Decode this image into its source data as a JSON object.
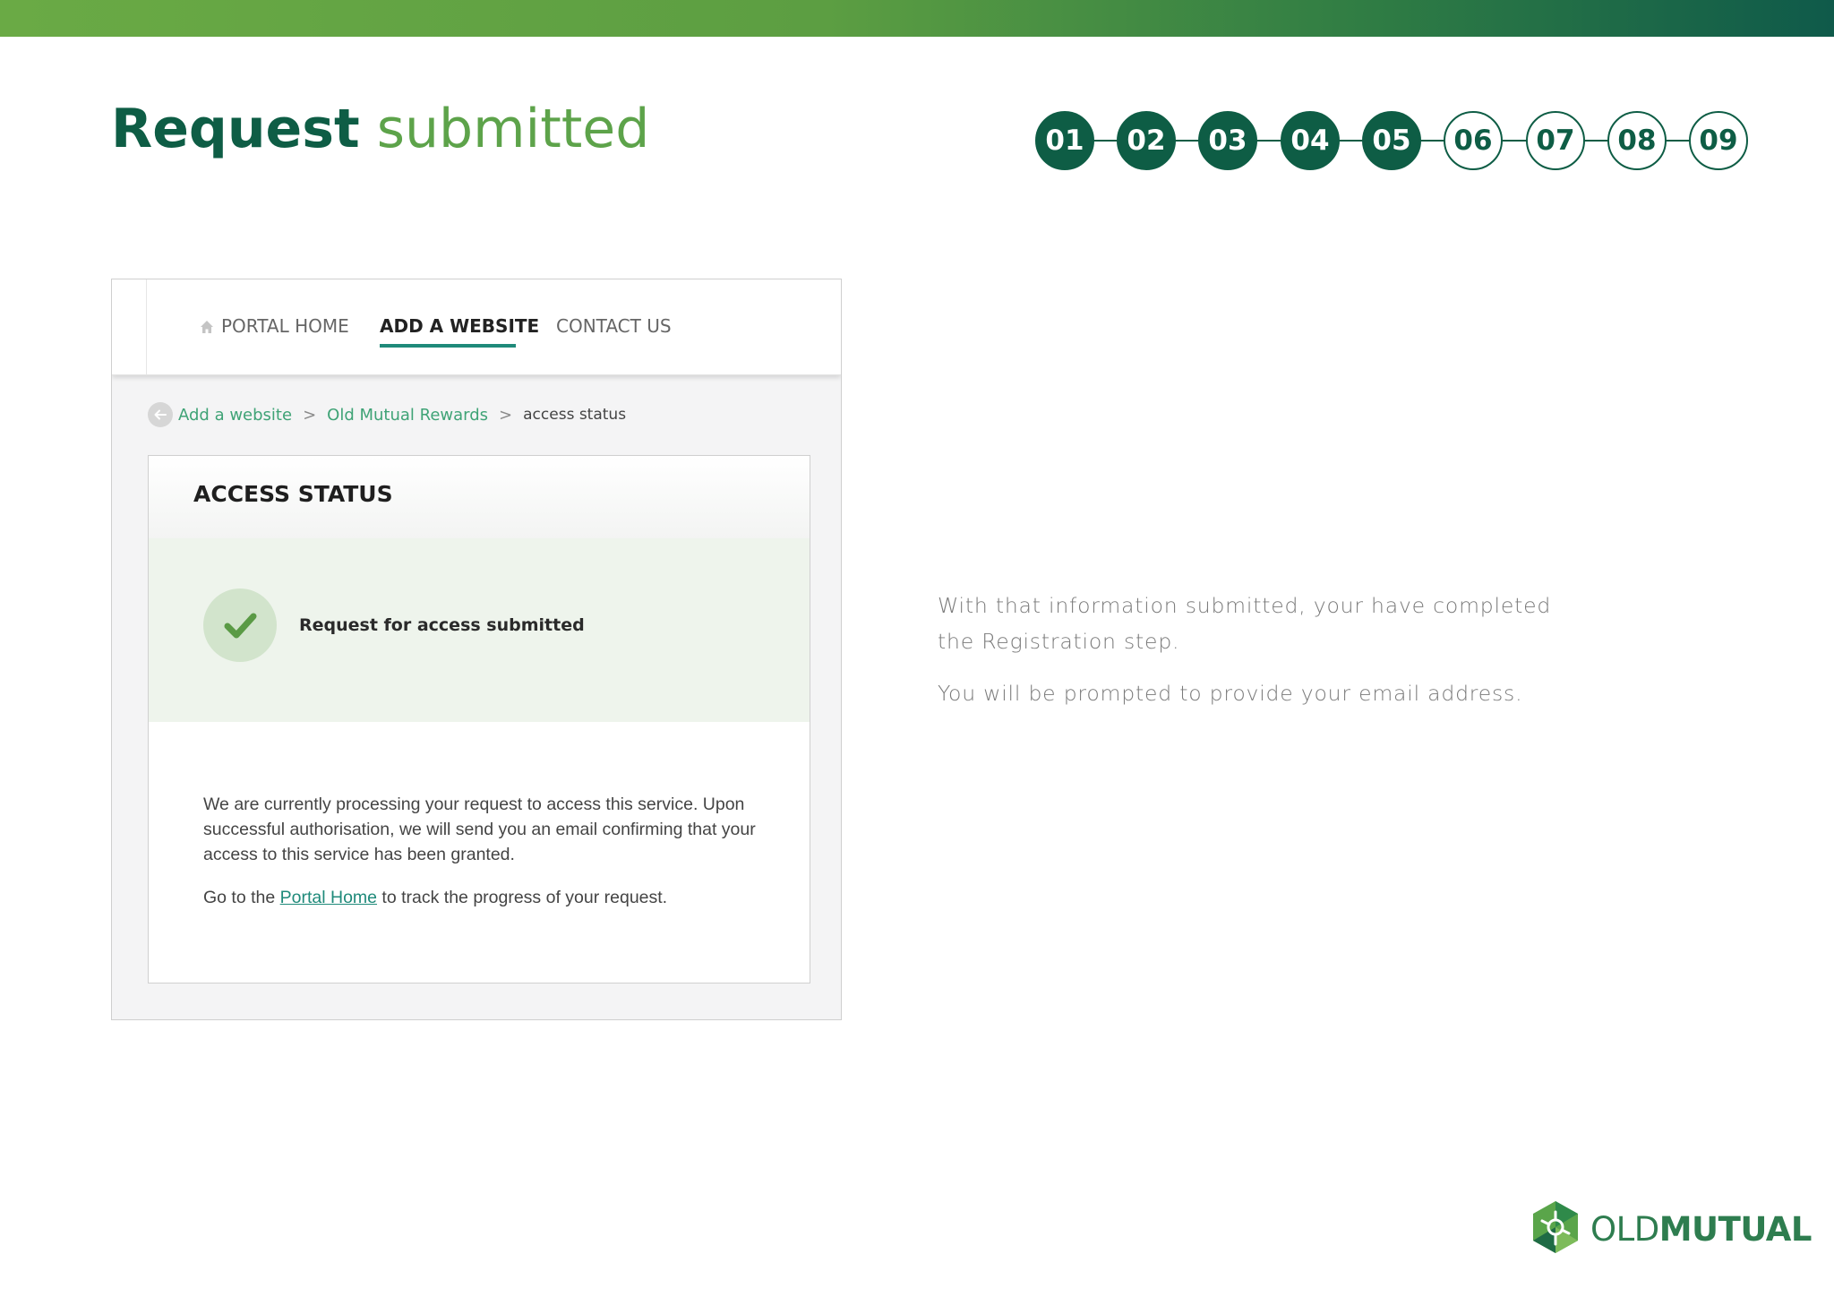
{
  "colors": {
    "brand_dark": "#0e5d45",
    "brand_light": "#5da34a",
    "link": "#1f8a7a"
  },
  "title": {
    "bold": "Request",
    "light": "submitted"
  },
  "steps": [
    {
      "label": "01",
      "state": "done"
    },
    {
      "label": "02",
      "state": "done"
    },
    {
      "label": "03",
      "state": "done"
    },
    {
      "label": "04",
      "state": "done"
    },
    {
      "label": "05",
      "state": "done"
    },
    {
      "label": "06",
      "state": "todo"
    },
    {
      "label": "07",
      "state": "todo"
    },
    {
      "label": "08",
      "state": "todo"
    },
    {
      "label": "09",
      "state": "todo"
    }
  ],
  "screenshot": {
    "nav": {
      "home": "PORTAL HOME",
      "home_icon": "house-icon",
      "add": "ADD A WEBSITE",
      "contact": "CONTACT US"
    },
    "breadcrumb": {
      "back_icon": "back-arrow-icon",
      "item1": "Add a website",
      "item2": "Old Mutual Rewards",
      "current": "access status",
      "separator": ">"
    },
    "card": {
      "title": "ACCESS STATUS",
      "check_icon": "checkmark-icon",
      "status": "Request for access submitted",
      "para1": "We are currently processing your request to access this service. Upon successful authorisation, we will send you an email confirming that your access to this service has been granted.",
      "para2_pre": "Go to the ",
      "para2_link": "Portal Home",
      "para2_post": " to track the progress of your request."
    }
  },
  "description": {
    "line1": "With that information submitted, your have completed the Registration step.",
    "line2": "You will be prompted to provide your email address."
  },
  "logo": {
    "light": "OLD",
    "bold": "MUTUAL",
    "icon": "old-mutual-emblem-icon"
  }
}
